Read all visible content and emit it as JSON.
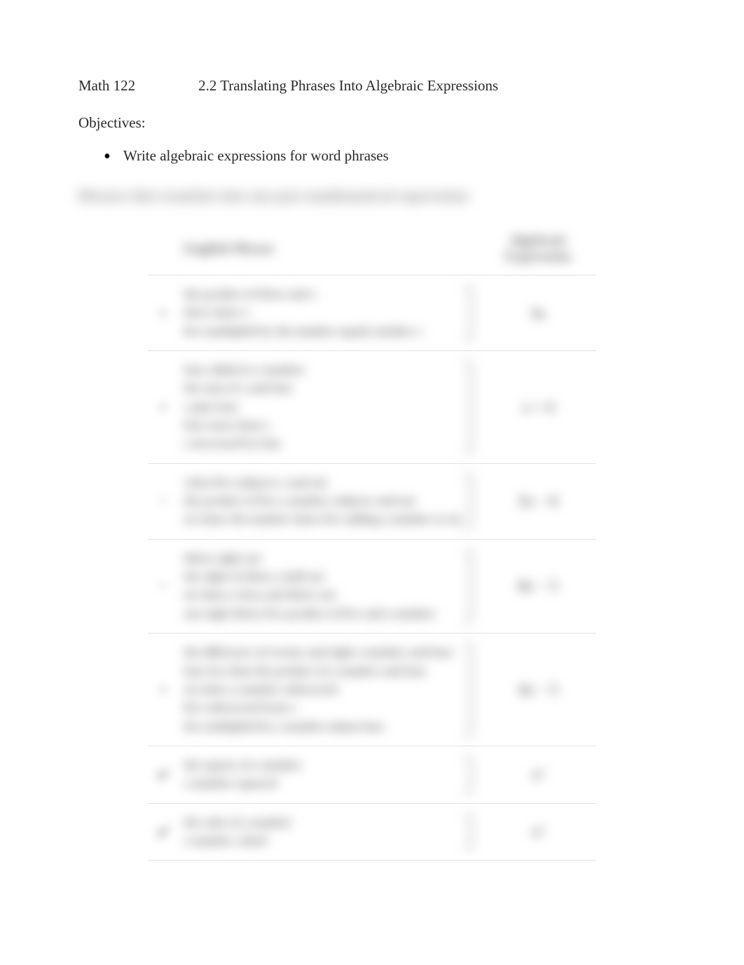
{
  "header": {
    "course": "Math 122",
    "section_title": "2.2 Translating Phrases Into Algebraic Expressions"
  },
  "objectives": {
    "label": "Objectives:",
    "items": [
      "Write algebraic expressions for word phrases"
    ]
  },
  "blurred": {
    "intro_line": "Phrases that translate into one-part mathematical expressions",
    "table_headers": {
      "operation": "",
      "phrase": "English Phrase",
      "expression": "Algebraic Expression"
    },
    "rows": [
      {
        "op": "+",
        "lines": [
          "the product of three and x",
          "three times x",
          "five multiplied by the number equals another x"
        ],
        "expr": "3x"
      },
      {
        "op": "+",
        "lines": [
          "four added to a number",
          "the sum of x and four",
          "x plus four",
          "four more than x",
          "x increased by four"
        ],
        "expr": "x + 4"
      },
      {
        "op": "−",
        "lines": [
          "when five subjects x and out",
          "the product of five a number subjects and out",
          "six times the number times five adding a number to six"
        ],
        "expr": "5x − 6"
      },
      {
        "op": "−",
        "lines": [
          "thirty eight out",
          "the eight of thirty a half out",
          "six times a beta and thirty out",
          "one eight thirty five product of five and a number"
        ],
        "expr": "8x − 5"
      },
      {
        "op": "÷",
        "lines": [
          "the difference of twenty and eight a number and four",
          "four less than the product of a number and four",
          "six times a number subtracted",
          "five subtracted from x",
          "five multiplied by a number minus four"
        ],
        "expr": "4x − 5"
      },
      {
        "op": "x²",
        "lines": [
          "the square of a number",
          "a number squared"
        ],
        "expr": "x²"
      },
      {
        "op": "x³",
        "lines": [
          "the cube of a number",
          "a number cubed"
        ],
        "expr": "x³"
      }
    ]
  }
}
